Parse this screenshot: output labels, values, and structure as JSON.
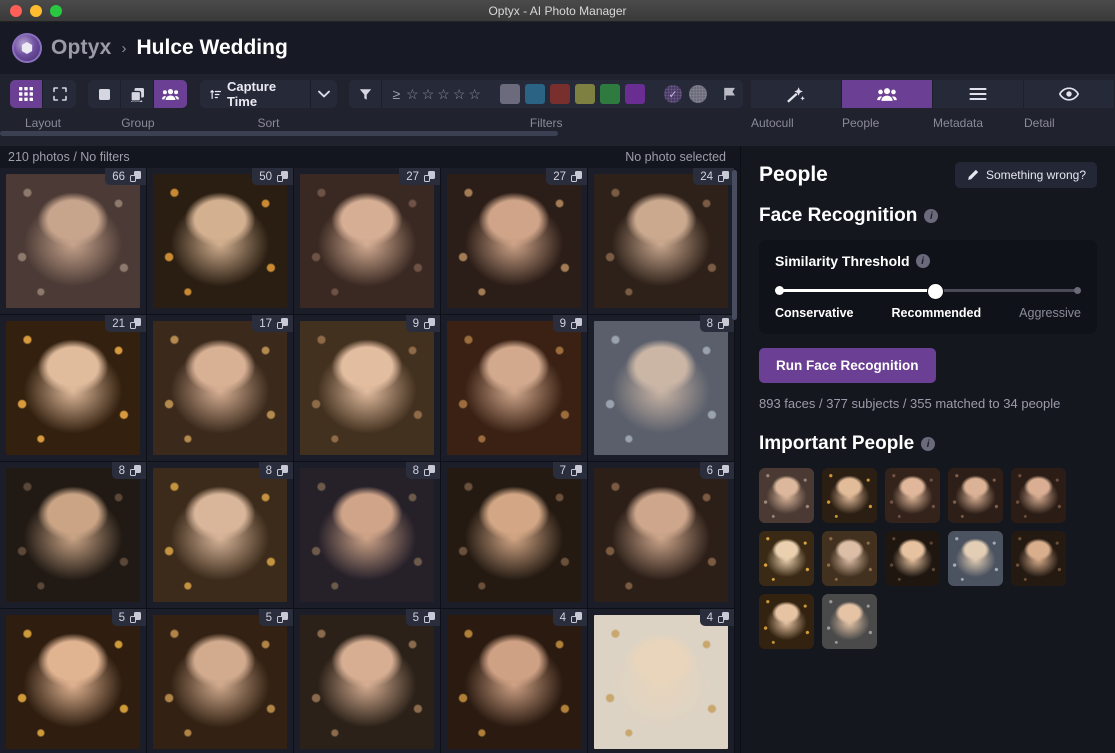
{
  "window": {
    "title": "Optyx - AI Photo Manager"
  },
  "header": {
    "brand": "Optyx",
    "separator": "›",
    "album": "Hulce Wedding"
  },
  "toolbar": {
    "groups": [
      {
        "label": "Layout",
        "buttons": [
          {
            "name": "grid-view-button",
            "icon": "grid-icon",
            "active": true
          },
          {
            "name": "fullscreen-view-button",
            "icon": "expand-icon",
            "active": false
          }
        ]
      },
      {
        "label": "Group",
        "buttons": [
          {
            "name": "group-none-button",
            "icon": "square-icon",
            "active": false
          },
          {
            "name": "group-stack-button",
            "icon": "stack-icon",
            "active": false
          },
          {
            "name": "group-people-button",
            "icon": "people-icon",
            "active": true
          }
        ]
      },
      {
        "label": "Sort",
        "sort_value": "Capture Time",
        "sort_icon": "sort-ascending-icon",
        "caret_icon": "chevron-down-icon"
      },
      {
        "label": "Filters",
        "funnel_icon": "funnel-icon",
        "rating_prefix": "≥",
        "stars": [
          "☆",
          "☆",
          "☆",
          "☆",
          "☆"
        ],
        "swatches": [
          "#6b6b7d",
          "#2b6384",
          "#7a2f2f",
          "#7d8040",
          "#2f7a3f",
          "#6a2e92"
        ],
        "circles": [
          {
            "name": "pick-circle",
            "color": "#4a3a66",
            "tick": "✓"
          },
          {
            "name": "reject-circle",
            "color": "#6d6d7b",
            "tick": ""
          }
        ],
        "flag_icon": "flag-icon"
      }
    ],
    "panels": [
      {
        "label": "Autocull",
        "icon": "magic-wand-icon",
        "active": false
      },
      {
        "label": "People",
        "icon": "people-icon",
        "active": true
      },
      {
        "label": "Metadata",
        "icon": "list-icon",
        "active": false
      },
      {
        "label": "Detail",
        "icon": "eye-icon",
        "active": false
      }
    ]
  },
  "status": {
    "left": "210 photos / No filters",
    "right": "No photo selected"
  },
  "grid": {
    "badge_icon": "stack-icon",
    "cells": [
      {
        "count": "66",
        "tone1": "#c7a48c",
        "tone2": "#4b3a35",
        "tone3": "#8e7a6d"
      },
      {
        "count": "50",
        "tone1": "#d3b090",
        "tone2": "#2a1e12",
        "tone3": "#c98a33"
      },
      {
        "count": "27",
        "tone1": "#d6ae94",
        "tone2": "#3a2922",
        "tone3": "#6d5245"
      },
      {
        "count": "27",
        "tone1": "#cfa488",
        "tone2": "#2b1d17",
        "tone3": "#a37c55"
      },
      {
        "count": "24",
        "tone1": "#cba98f",
        "tone2": "#2e2119",
        "tone3": "#7a5c44"
      },
      {
        "count": "21",
        "tone1": "#e0bb9c",
        "tone2": "#33200f",
        "tone3": "#d79a3f"
      },
      {
        "count": "17",
        "tone1": "#d8b094",
        "tone2": "#3b2a1c",
        "tone3": "#b58a4e"
      },
      {
        "count": "9",
        "tone1": "#e3bda0",
        "tone2": "#43311f",
        "tone3": "#8e6b48"
      },
      {
        "count": "9",
        "tone1": "#d2a98d",
        "tone2": "#3a2114",
        "tone3": "#9c6d3c"
      },
      {
        "count": "8",
        "tone1": "#cbb6a6",
        "tone2": "#5a5f6b",
        "tone3": "#9aa2ad"
      },
      {
        "count": "8",
        "tone1": "#caa485",
        "tone2": "#211a14",
        "tone3": "#5b4738"
      },
      {
        "count": "8",
        "tone1": "#d9b69a",
        "tone2": "#3c2b1b",
        "tone3": "#c4933f"
      },
      {
        "count": "8",
        "tone1": "#cfa488",
        "tone2": "#262029",
        "tone3": "#6c5a4a"
      },
      {
        "count": "7",
        "tone1": "#d3a785",
        "tone2": "#241a12",
        "tone3": "#6a503a"
      },
      {
        "count": "6",
        "tone1": "#cda68b",
        "tone2": "#2c1f18",
        "tone3": "#7b5a42"
      },
      {
        "count": "5",
        "tone1": "#e0b391",
        "tone2": "#2f1e10",
        "tone3": "#cf9a38"
      },
      {
        "count": "5",
        "tone1": "#d2ab8e",
        "tone2": "#332213",
        "tone3": "#b08347"
      },
      {
        "count": "5",
        "tone1": "#d7ae92",
        "tone2": "#2b2118",
        "tone3": "#8a6a4c"
      },
      {
        "count": "4",
        "tone1": "#cfa184",
        "tone2": "#2a1a10",
        "tone3": "#b07f38"
      },
      {
        "count": "4",
        "tone1": "#e8d5bc",
        "tone2": "#ddd3c4",
        "tone3": "#c9a86f"
      }
    ]
  },
  "people_panel": {
    "title": "People",
    "something_wrong": {
      "label": "Something wrong?",
      "icon": "pencil-icon"
    },
    "face_recognition": {
      "title": "Face Recognition",
      "info_icon": "info-icon",
      "threshold_label": "Similarity Threshold",
      "threshold_info_icon": "info-icon",
      "slider": {
        "value_percent": 52,
        "min_label": "Conservative",
        "mid_label": "Recommended",
        "max_label": "Aggressive"
      },
      "run_button": "Run Face Recognition",
      "stats": "893 faces / 377 subjects / 355 matched to 34 people"
    },
    "important_people": {
      "title": "Important People",
      "info_icon": "info-icon",
      "faces": [
        {
          "tone1": "#dcb79c",
          "tone2": "#4a3a33",
          "tone3": "#9b8678"
        },
        {
          "tone1": "#e2bb99",
          "tone2": "#2b1e12",
          "tone3": "#cf9536"
        },
        {
          "tone1": "#e0b79a",
          "tone2": "#33231a",
          "tone3": "#705244"
        },
        {
          "tone1": "#dcb296",
          "tone2": "#2d1f18",
          "tone3": "#7d5d48"
        },
        {
          "tone1": "#d9ae93",
          "tone2": "#2b1d16",
          "tone3": "#6b4e3f"
        },
        {
          "tone1": "#ead0af",
          "tone2": "#3a2a15",
          "tone3": "#d7a33f"
        },
        {
          "tone1": "#dcbda6",
          "tone2": "#42311f",
          "tone3": "#8e6b48"
        },
        {
          "tone1": "#e7c2a0",
          "tone2": "#1e160f",
          "tone3": "#5b4535"
        },
        {
          "tone1": "#e3cdb4",
          "tone2": "#4b5360",
          "tone3": "#a3abb5"
        },
        {
          "tone1": "#d9ae8c",
          "tone2": "#241a12",
          "tone3": "#6a503a"
        },
        {
          "tone1": "#e6c3a3",
          "tone2": "#32220f",
          "tone3": "#cb9838"
        },
        {
          "tone1": "#e5c4a6",
          "tone2": "#4a4a4a",
          "tone3": "#9a9a9a"
        }
      ]
    }
  }
}
